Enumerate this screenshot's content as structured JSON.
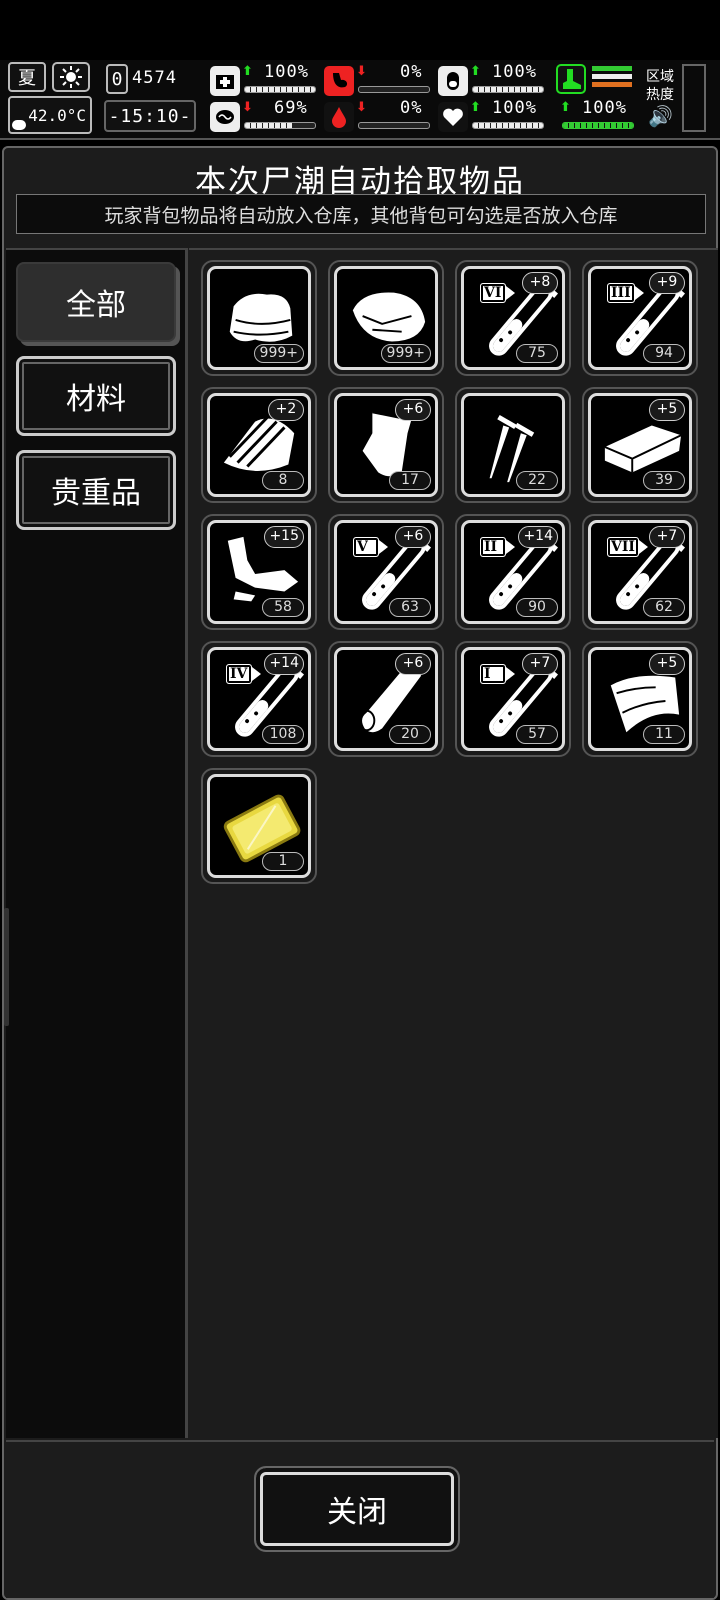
{
  "hud": {
    "season": "夏",
    "temperature": "42.0°C",
    "day_counter": "4574",
    "day_prefix": "0",
    "clock": "-15:10-",
    "stats": [
      {
        "name": "health",
        "value": "100%",
        "trend": "up",
        "fill": 1.0
      },
      {
        "name": "hunger",
        "value": "0%",
        "trend": "down",
        "fill": 0.0
      },
      {
        "name": "medicine",
        "value": "100%",
        "trend": "up",
        "fill": 1.0
      },
      {
        "name": "stamina",
        "value": "100%",
        "trend": "up",
        "fill": 1.0
      },
      {
        "name": "mental",
        "value": "69%",
        "trend": "down",
        "fill": 0.69
      },
      {
        "name": "thirst",
        "value": "0%",
        "trend": "down",
        "fill": 0.0
      },
      {
        "name": "heart",
        "value": "100%",
        "trend": "up",
        "fill": 1.0
      }
    ],
    "region_heat_label": "区域热度",
    "colors": {
      "up": "#22dd22",
      "down": "#ee2222",
      "green_bar": "#33cc33",
      "orange_bar": "#e07020"
    }
  },
  "window": {
    "title": "本次尸潮自动拾取物品",
    "notice": "玩家背包物品将自动放入仓库，其他背包可勾选是否放入仓库",
    "tabs": [
      {
        "label": "全部",
        "active": true
      },
      {
        "label": "材料",
        "active": false
      },
      {
        "label": "贵重品",
        "active": false
      }
    ],
    "close_label": "关闭"
  },
  "items": [
    {
      "icon": "cloth-icon",
      "count": "999+",
      "bonus": "",
      "tier": ""
    },
    {
      "icon": "raw-meat-icon",
      "count": "999+",
      "bonus": "",
      "tier": ""
    },
    {
      "icon": "test-tube-icon",
      "count": "75",
      "bonus": "+8",
      "tier": "VI"
    },
    {
      "icon": "test-tube-icon",
      "count": "94",
      "bonus": "+9",
      "tier": "III"
    },
    {
      "icon": "wood-planks-icon",
      "count": "8",
      "bonus": "+2",
      "tier": ""
    },
    {
      "icon": "plastic-bag-icon",
      "count": "17",
      "bonus": "+6",
      "tier": ""
    },
    {
      "icon": "screws-icon",
      "count": "22",
      "bonus": "",
      "tier": ""
    },
    {
      "icon": "brick-icon",
      "count": "39",
      "bonus": "+5",
      "tier": ""
    },
    {
      "icon": "scrap-parts-icon",
      "count": "58",
      "bonus": "+15",
      "tier": ""
    },
    {
      "icon": "test-tube-icon",
      "count": "63",
      "bonus": "+6",
      "tier": "V"
    },
    {
      "icon": "test-tube-icon",
      "count": "90",
      "bonus": "+14",
      "tier": "II"
    },
    {
      "icon": "test-tube-icon",
      "count": "62",
      "bonus": "+7",
      "tier": "VII"
    },
    {
      "icon": "test-tube-icon",
      "count": "108",
      "bonus": "+14",
      "tier": "IV"
    },
    {
      "icon": "log-icon",
      "count": "20",
      "bonus": "+6",
      "tier": ""
    },
    {
      "icon": "test-tube-icon",
      "count": "57",
      "bonus": "+7",
      "tier": "I"
    },
    {
      "icon": "fabric-sheet-icon",
      "count": "11",
      "bonus": "+5",
      "tier": ""
    },
    {
      "icon": "gold-card-icon",
      "count": "1",
      "bonus": "",
      "tier": ""
    }
  ]
}
